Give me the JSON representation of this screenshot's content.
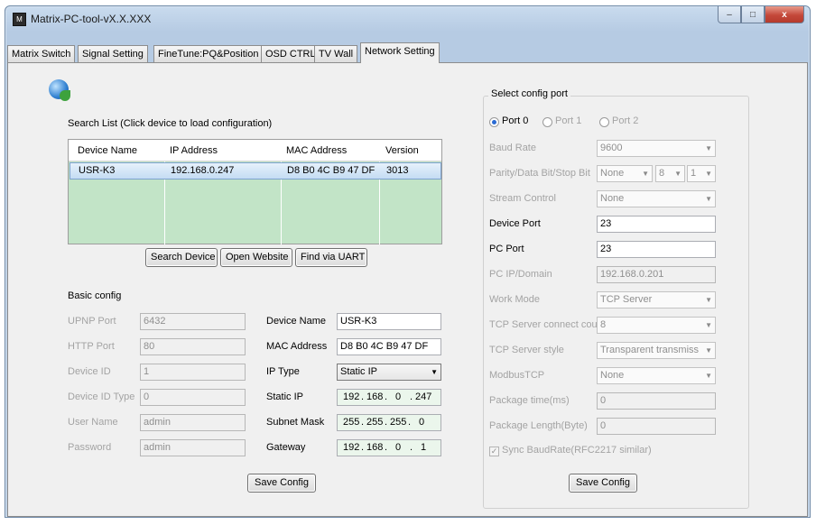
{
  "window": {
    "title": "Matrix-PC-tool-vX.X.XXX",
    "icon_label": "M",
    "controls": {
      "minimize": "–",
      "maximize": "□",
      "close": "x"
    }
  },
  "tabs": [
    {
      "label": "Matrix Switch"
    },
    {
      "label": "Signal Setting"
    },
    {
      "label": "FineTune:PQ&Position"
    },
    {
      "label": "OSD CTRL"
    },
    {
      "label": "TV Wall"
    },
    {
      "label": "Network Setting"
    }
  ],
  "active_tab": "Network Setting",
  "search": {
    "title": "Search List (Click device to load configuration)",
    "columns": [
      "Device Name",
      "IP Address",
      "MAC Address",
      "Version"
    ],
    "rows": [
      {
        "device_name": "USR-K3",
        "ip": "192.168.0.247",
        "mac": "D8 B0 4C B9 47 DF",
        "version": "3013"
      }
    ],
    "buttons": {
      "search": "Search Device",
      "website": "Open Website",
      "uart": "Find via UART"
    }
  },
  "basic_config": {
    "title": "Basic config",
    "upnp_port_label": "UPNP Port",
    "upnp_port": "6432",
    "http_port_label": "HTTP Port",
    "http_port": "80",
    "device_id_label": "Device ID",
    "device_id": "1",
    "device_id_type_label": "Device ID Type",
    "device_id_type": "0",
    "user_name_label": "User Name",
    "user_name": "admin",
    "password_label": "Password",
    "password": "admin",
    "device_name_label": "Device Name",
    "device_name": "USR-K3",
    "mac_label": "MAC Address",
    "mac": "D8 B0 4C B9 47 DF",
    "ip_type_label": "IP Type",
    "ip_type": "Static IP",
    "static_ip_label": "Static IP",
    "static_ip": [
      "192",
      "168",
      "0",
      "247"
    ],
    "subnet_label": "Subnet Mask",
    "subnet": [
      "255",
      "255",
      "255",
      "0"
    ],
    "gateway_label": "Gateway",
    "gateway": [
      "192",
      "168",
      "0",
      "1"
    ],
    "save_label": "Save Config"
  },
  "port_config": {
    "title": "Select config port",
    "ports": [
      "Port 0",
      "Port 1",
      "Port 2"
    ],
    "selected_port": "Port 0",
    "baud_rate_label": "Baud Rate",
    "baud_rate": "9600",
    "parity_label": "Parity/Data Bit/Stop Bit",
    "parity": "None",
    "data_bit": "8",
    "stop_bit": "1",
    "stream_label": "Stream Control",
    "stream": "None",
    "device_port_label": "Device Port",
    "device_port": "23",
    "pc_port_label": "PC Port",
    "pc_port": "23",
    "pc_ip_label": "PC IP/Domain",
    "pc_ip": "192.168.0.201",
    "work_mode_label": "Work Mode",
    "work_mode": "TCP Server",
    "tcp_conn_label": "TCP Server connect cou",
    "tcp_conn": "8",
    "tcp_style_label": "TCP Server style",
    "tcp_style": "Transparent transmiss",
    "modbus_label": "ModbusTCP",
    "modbus": "None",
    "pkg_time_label": "Package time(ms)",
    "pkg_time": "0",
    "pkg_len_label": "Package Length(Byte)",
    "pkg_len": "0",
    "sync_label": "Sync BaudRate(RFC2217 similar)",
    "save_label": "Save Config"
  }
}
